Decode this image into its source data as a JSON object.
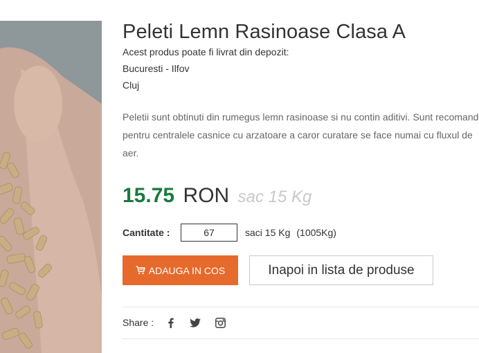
{
  "product": {
    "title": "Peleti Lemn Rasinoase Clasa A",
    "delivery_intro": "Acest produs poate fi livrat din depozit:",
    "depots": [
      "Bucuresti - Ilfov",
      "Cluj"
    ],
    "description": "Peletii sunt obtinuti din rumegus lemn rasinoase si nu contin aditivi. Sunt recomandati pentru centralele casnice cu arzatoare a caror curatare se face numai cu fluxul de aer."
  },
  "pricing": {
    "price": "15.75",
    "currency": "RON",
    "unit_note": "sac 15 Kg"
  },
  "quantity": {
    "label": "Cantitate :",
    "value": "67",
    "unit": "saci 15 Kg",
    "total": "(1005Kg)"
  },
  "actions": {
    "add_to_cart": "ADAUGA IN COS",
    "back_to_list": "Inapoi in lista de produse"
  },
  "share": {
    "label": "Share :",
    "icons": [
      "facebook-icon",
      "twitter-icon",
      "instagram-icon"
    ]
  },
  "colors": {
    "price": "#1a7a3c",
    "add_button": "#e66a2c",
    "unit_note": "#c8c8c8"
  }
}
